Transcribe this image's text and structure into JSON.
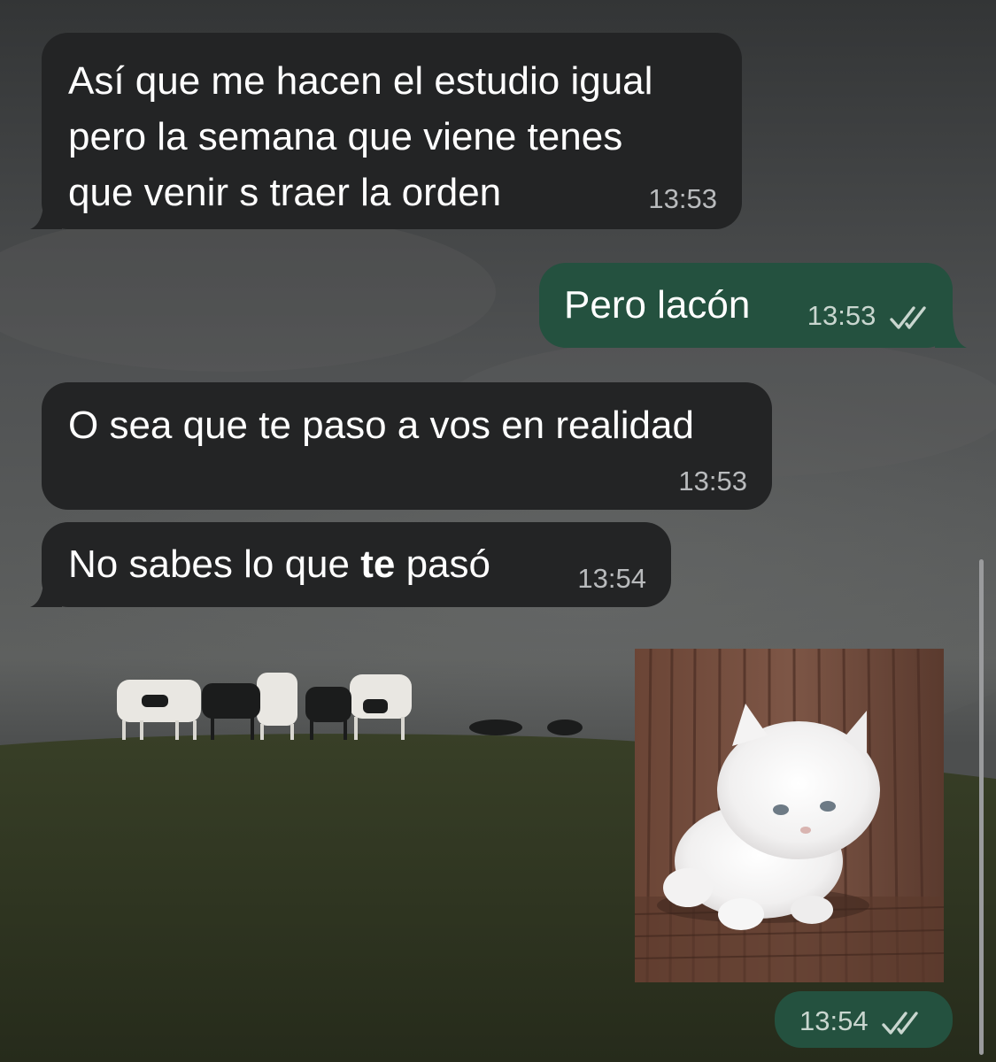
{
  "conversation": {
    "messages": [
      {
        "direction": "incoming",
        "lines": [
          "Así que me hacen el estudio igual",
          "pero la semana que viene tenes",
          "que venir s traer la orden"
        ],
        "time": "13:53"
      },
      {
        "direction": "outgoing",
        "text": "Pero lacón",
        "time": "13:53",
        "status": "read"
      },
      {
        "direction": "incoming",
        "text": "O sea que te paso a vos en realidad",
        "time": "13:53"
      },
      {
        "direction": "incoming",
        "text_before": "No sabes lo que ",
        "text_bold": "te",
        "text_after": " pasó",
        "time": "13:54"
      },
      {
        "direction": "outgoing",
        "type": "photo",
        "photo_subject": "white-kitten",
        "time": "13:54",
        "status": "read"
      }
    ]
  },
  "colors": {
    "incoming_bubble": "#232425",
    "outgoing_bubble": "#24513f",
    "read_ticks": "#c9d6cf",
    "wallpaper_sky": "#4a4c4d",
    "wallpaper_field": "#2f3621"
  },
  "icons": {
    "read_receipt": "double-check-icon"
  }
}
